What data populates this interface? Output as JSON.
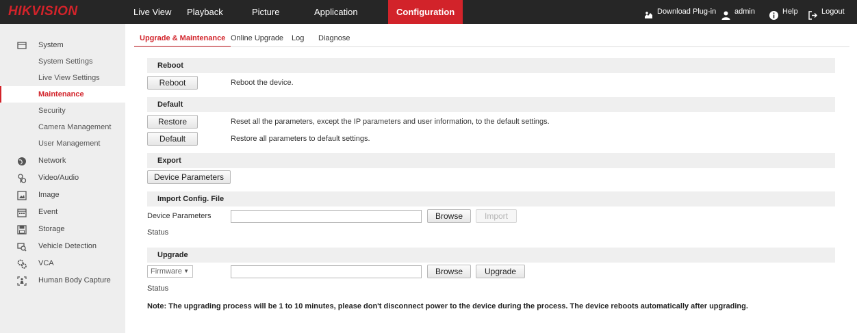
{
  "brand": "HIKVISION",
  "colors": {
    "accent": "#d2232a",
    "topbar": "#262626",
    "sidebar": "#eeeeee",
    "section": "#efefef"
  },
  "nav": [
    {
      "label": "Live View"
    },
    {
      "label": "Playback"
    },
    {
      "label": "Picture"
    },
    {
      "label": "Application"
    },
    {
      "label": "Configuration"
    }
  ],
  "top_right": {
    "plugin": "Download Plug-in",
    "user": "admin",
    "help": "Help",
    "logout": "Logout"
  },
  "sidebar": {
    "system": "System",
    "system_sub": [
      "System Settings",
      "Live View Settings",
      "Maintenance",
      "Security",
      "Camera Management",
      "User Management"
    ],
    "groups": [
      "Network",
      "Video/Audio",
      "Image",
      "Event",
      "Storage",
      "Vehicle Detection",
      "VCA",
      "Human Body Capture"
    ]
  },
  "tabs": [
    "Upgrade & Maintenance",
    "Online Upgrade",
    "Log",
    "Diagnose"
  ],
  "reboot": {
    "title": "Reboot",
    "button": "Reboot",
    "desc": "Reboot the device."
  },
  "default": {
    "title": "Default",
    "restore_button": "Restore",
    "restore_desc": "Reset all the parameters, except the IP parameters and user information, to the default settings.",
    "default_button": "Default",
    "default_desc": "Restore all parameters to default settings."
  },
  "export": {
    "title": "Export",
    "button": "Device Parameters"
  },
  "import": {
    "title": "Import Config. File",
    "label": "Device Parameters",
    "browse": "Browse",
    "import": "Import",
    "status": "Status"
  },
  "upgrade": {
    "title": "Upgrade",
    "select": "Firmware",
    "browse": "Browse",
    "upgrade": "Upgrade",
    "status": "Status"
  },
  "note": "Note: The upgrading process will be 1 to 10 minutes, please don't disconnect power to the device during the process. The device reboots automatically after upgrading."
}
